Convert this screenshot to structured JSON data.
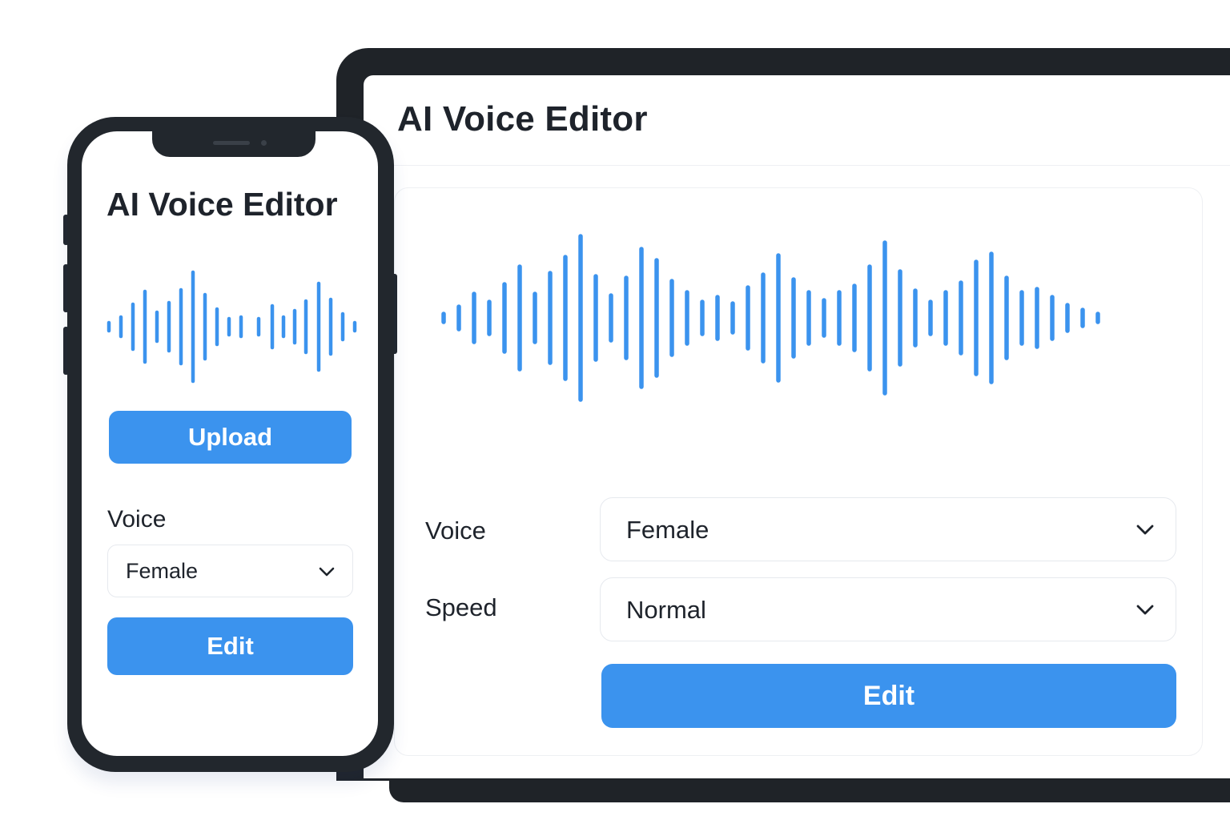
{
  "desktop": {
    "title": "AI Voice Editor",
    "voice_label": "Voice",
    "voice_value": "Female",
    "speed_label": "Speed",
    "speed_value": "Normal",
    "edit_label": "Edit"
  },
  "mobile": {
    "title": "AI Voice Editor",
    "upload_label": "Upload",
    "voice_label": "Voice",
    "voice_value": "Female",
    "edit_label": "Edit"
  },
  "colors": {
    "accent": "#3b93ee",
    "device_frame": "#1f2328",
    "text": "#1e232b"
  },
  "icons": [
    "chevron-down-icon",
    "waveform-icon"
  ]
}
